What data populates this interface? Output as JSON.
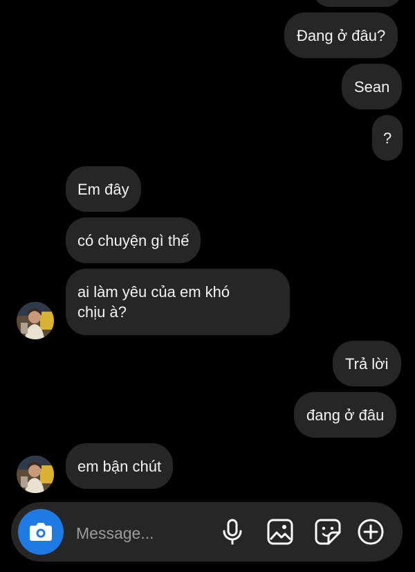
{
  "thread": {
    "outgoing_1": "Đang ở đâu?",
    "outgoing_2": "Sean",
    "outgoing_3": "?",
    "incoming_1": "Em đây",
    "incoming_2": "có chuyện gì thế",
    "incoming_3_line1": "ai làm yêu của em khó",
    "incoming_3_line2": "chịu à?",
    "outgoing_4": "Trả lời",
    "outgoing_5": "đang ở đâu",
    "incoming_4": "em bận chút"
  },
  "composer": {
    "placeholder": "Message...",
    "icons": [
      "camera-icon",
      "microphone-icon",
      "gallery-icon",
      "sticker-icon",
      "plus-icon"
    ],
    "accent": "#1f7ae6"
  },
  "colors": {
    "background": "#000000",
    "bubble": "#262626",
    "text": "#f5f5f5"
  }
}
